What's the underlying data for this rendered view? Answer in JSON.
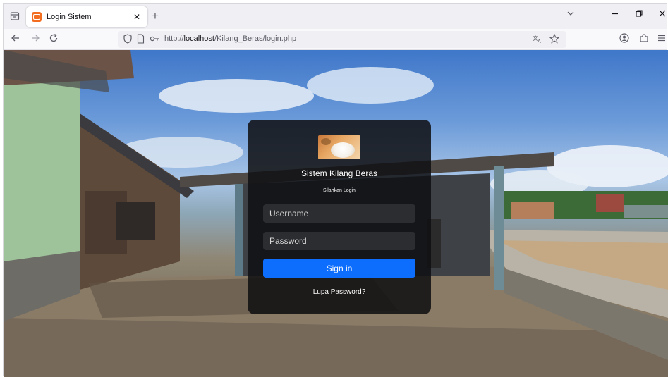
{
  "browser": {
    "tab": {
      "title": "Login Sistem"
    },
    "url": {
      "scheme": "http://",
      "host": "localhost",
      "path": "/Kilang_Beras/login.php"
    }
  },
  "login": {
    "title": "Sistem Kilang Beras",
    "subtitle": "Silahkan Login",
    "username_placeholder": "Username",
    "password_placeholder": "Password",
    "signin_label": "Sign in",
    "forgot_label": "Lupa Password?"
  },
  "colors": {
    "primary_button": "#0d6efd",
    "card_background": "rgba(15,15,18,0.86)",
    "favicon": "#f36d20"
  },
  "icons": {
    "tab_list": "tab-list-icon",
    "favicon": "xampp-icon",
    "tab_close": "close-icon",
    "new_tab": "plus-icon",
    "list_all_tabs": "chevron-down-icon",
    "minimize": "minimize-icon",
    "restore": "restore-icon",
    "close_window": "close-icon",
    "back": "back-arrow-icon",
    "forward": "forward-arrow-icon",
    "reload": "reload-icon",
    "tracking_protection": "shield-icon",
    "page_info": "page-icon",
    "permissions": "key-icon",
    "translate": "translate-icon",
    "bookmark": "star-icon",
    "account": "account-icon",
    "extensions": "extensions-icon",
    "menu": "hamburger-menu-icon"
  }
}
